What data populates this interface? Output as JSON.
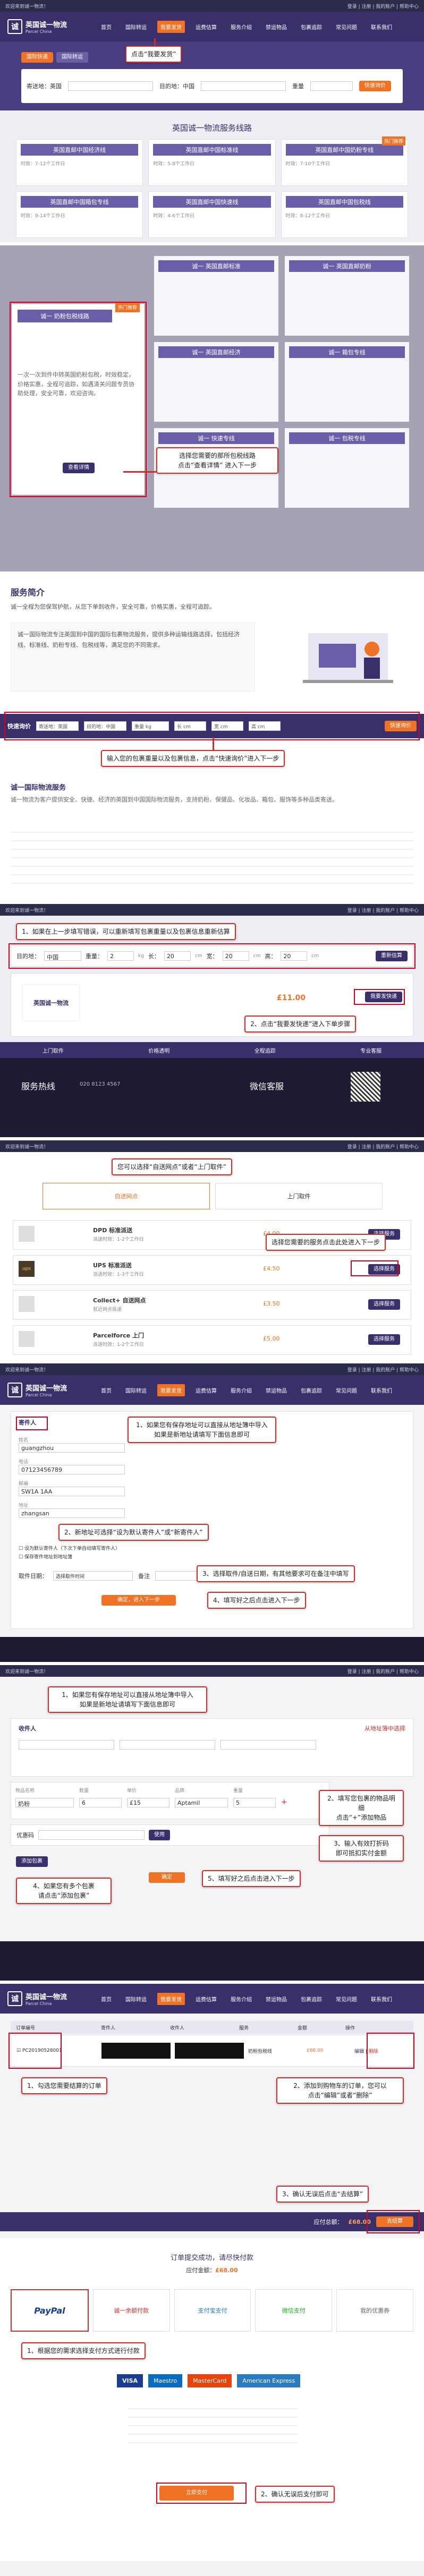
{
  "brand": {
    "name_cn": "英国诚一物流",
    "name_en": "Parcel China",
    "mark": "诚"
  },
  "topbar": {
    "left": "欢迎来到诚一物流！",
    "right": "登录 | 注册 | 我的账户 | 帮助中心"
  },
  "nav": [
    "首页",
    "国际转运",
    "我要发货",
    "运费估算",
    "服务介绍",
    "禁运物品",
    "包裹追踪",
    "常见问题",
    "联系我们"
  ],
  "step1": {
    "callout": "点击“我要发货”",
    "tabs": [
      "国际快递",
      "国际转运"
    ],
    "from_label": "寄送地：英国",
    "to_label": "目的地：中国",
    "weight_label": "重量",
    "estimate_btn": "快速询价",
    "banner_title": "英国诚一物流服务线路",
    "featured_tag": "热门推荐",
    "cards": [
      {
        "title": "英国直邮中国经济线",
        "desc": "时效：7-12个工作日"
      },
      {
        "title": "英国直邮中国标准线",
        "desc": "时效：5-8个工作日"
      },
      {
        "title": "英国直邮中国奶粉专线",
        "desc": "时效：7-10个工作日"
      },
      {
        "title": "英国直邮中国箱包专线",
        "desc": "时效：8-14个工作日"
      },
      {
        "title": "英国直邮中国快速线",
        "desc": "时效：4-6个工作日"
      },
      {
        "title": "英国直邮中国包税线",
        "desc": "时效：8-12个工作日"
      }
    ]
  },
  "step2": {
    "callout": "选择您需要的那所包税线路\n点击“查看详情” 进入下一步",
    "card_title": "诚一 奶粉包税线路",
    "card_btn": "查看详情",
    "card_desc": "一次一次到件中转英国奶粉包税，时效稳定，价格实惠，全程可追踪，如遇清关问题专员协助处理，安全可靠，欢迎咨询。",
    "other_titles": [
      "诚一 英国直邮标准",
      "诚一 英国直邮奶粉",
      "诚一 英国直邮经济",
      "诚一 箱包专线",
      "诚一 快速专线",
      "诚一 包税专线"
    ]
  },
  "step3": {
    "section_title": "服务简介",
    "intro": "诚一全程为您保驾护航，从您下单到收件，安全可靠，价格实惠，全程可追踪。",
    "intro2": "诚一国际物流专注英国到中国的国际包裹物流服务，提供多种运输线路选择，包括经济线、标准线、奶粉专线、包税线等，满足您的不同需求。",
    "callout": "输入您的包裹重量以及包裹信息，点击“快速询价”进入下一步",
    "bar_label": "快速询价",
    "bar_fields": [
      "寄送地：英国",
      "目的地：中国",
      "重量 kg",
      "长 cm",
      "宽 cm",
      "高 cm"
    ],
    "bar_btn": "快速询价",
    "section2": "诚一国际物流服务",
    "section2_text": "诚一物流为客户提供安全、快捷、经济的英国到中国国际物流服务，支持奶粉、保健品、化妆品、箱包、服饰等多种品类寄送。"
  },
  "step4": {
    "callout1": "1、如果在上一步填写错误，可以重新填写包裹重量以及包裹信息重新估算",
    "callout2": "2、点击“我要发快递”进入下单步骤",
    "form_labels": [
      "目的地：",
      "重量：",
      "长：",
      "宽：",
      "高："
    ],
    "form_values": [
      "中国",
      "2",
      "20",
      "20",
      "20"
    ],
    "form_units": [
      "kg",
      "cm",
      "cm",
      "cm"
    ],
    "form_btn": "重新估算",
    "result_price": "£11.00",
    "result_btn": "我要发快递",
    "features": [
      "上门取件",
      "价格透明",
      "全程追踪",
      "专业客服"
    ],
    "footer_service": "服务热线",
    "footer_phone": "020 8123 4567",
    "footer_wechat": "微信客服"
  },
  "step5": {
    "callout1": "您可以选择“自送网点”或者“上门取件”",
    "callout2": "选择您需要的服务点击此处进入下一步",
    "dropoff": "自送网点",
    "collection": "上门取件",
    "services": [
      {
        "name": "DPD 标准派送",
        "desc": "派送时效：1-2个工作日",
        "price": "£4.00",
        "btn": "选择服务"
      },
      {
        "name": "UPS 标准派送",
        "desc": "派送时效：1-3个工作日",
        "price": "£4.50",
        "btn": "选择服务"
      },
      {
        "name": "Collect+ 自送网点",
        "desc": "就近网点投递",
        "price": "£3.50",
        "btn": "选择服务"
      },
      {
        "name": "Parcelforce 上门",
        "desc": "派送时效：1-2个工作日",
        "price": "£5.00",
        "btn": "选择服务"
      }
    ]
  },
  "step6": {
    "sender_title": "寄件人",
    "callout1": "1、如果您有保存地址可以直接从地址簿中导入\n如果是新地址请填写下面信息即可",
    "callout2": "2、新地址可选择“设为默认寄件人”或“新寄件人”",
    "callout3": "3、选择取件/自送日期，有其他要求可在备注中填写",
    "callout4": "4、填写好之后点击进入下一步",
    "fields": [
      {
        "label": "姓名",
        "value": "guangzhou"
      },
      {
        "label": "电话",
        "value": "07123456789"
      },
      {
        "label": "邮编",
        "value": "SW1A 1AA"
      },
      {
        "label": "地址",
        "value": "zhangsan"
      }
    ],
    "option1": "设为默认寄件人（下次下单自动填写寄件人）",
    "option2": "保存寄件地址到地址簿",
    "date_label": "取件日期：",
    "date_value": "选择取件时间",
    "remark_label": "备注",
    "next_btn": "确定，进入下一步"
  },
  "step7": {
    "callout1": "1、如果您有保存地址可以直接从地址簿中导入\n如果是新地址请填写下面信息即可",
    "callout2": "2、填写您包裹的物品明细\n点击“+”添加物品",
    "callout3": "3、输入有效打折码\n即可抵扣实付金额",
    "callout4": "4、如果您有多个包裹\n请点击“添加包裹”",
    "callout5": "5、填写好之后点击进入下一步",
    "recipient_title": "收件人",
    "addr_book": "从地址簿中选择",
    "item_headers": [
      "物品名称",
      "数量",
      "单价",
      "品牌",
      "重量"
    ],
    "item_values": [
      "奶粉",
      "6",
      "£15",
      "Aptamil",
      "5"
    ],
    "coupon_label": "优惠码",
    "coupon_btn": "使用",
    "add_parcel": "添加包裹",
    "next_btn": "确定"
  },
  "step8": {
    "callout1": "1、勾选您需要结算的订单",
    "callout2": "2、添加到购物车的订单，您可以\n点击“编辑”或者“删除”",
    "callout3": "3、确认无误后点击“去结算”",
    "headers": [
      "订单编号",
      "寄件人",
      "收件人",
      "服务",
      "金额",
      "操作"
    ],
    "order_id": "PC20190528001",
    "service": "奶粉包税线",
    "price": "£68.00",
    "edit": "编辑",
    "delete": "删除",
    "total_label": "应付总额：",
    "total": "£68.00",
    "checkout_btn": "去结算"
  },
  "step9": {
    "pay_title": "订单提交成功，请尽快付款",
    "pay_amount_label": "应付金额：",
    "pay_amount": "£68.00",
    "methods": [
      "PayPal",
      "诚一余额付款",
      "支付宝支付",
      "微信支付",
      "我的优惠券"
    ],
    "callout1": "1、根据您的需求选择支付方式进行付款",
    "cards": [
      "VISA",
      "Maestro",
      "MasterCard",
      "American Express"
    ],
    "callout2": "2、确认无误后支付即可",
    "pay_btn": "立即支付"
  }
}
